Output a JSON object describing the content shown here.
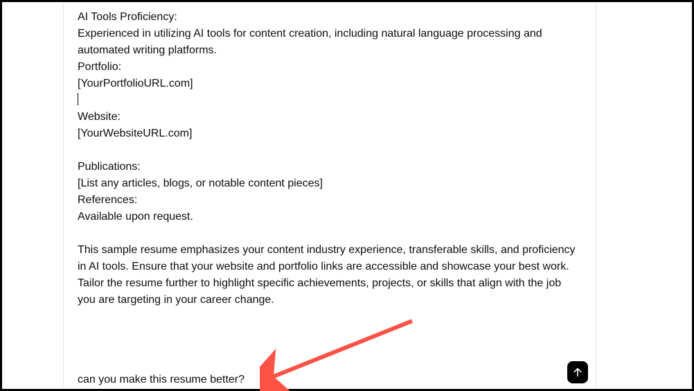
{
  "message": {
    "line1": "AI Tools Proficiency:",
    "line2": "Experienced in utilizing AI tools for content creation, including natural language processing and automated writing platforms.",
    "line3": "Portfolio:",
    "line4": "[YourPortfolioURL.com]",
    "line5": "Website:",
    "line6": "[YourWebsiteURL.com]",
    "line7": "Publications:",
    "line8": "[List any articles, blogs, or notable content pieces]",
    "line9": "References:",
    "line10": "Available upon request.",
    "line11": "This sample resume emphasizes your content industry experience, transferable skills, and proficiency in AI tools. Ensure that your website and portfolio links are accessible and showcase your best work. Tailor the resume further to highlight specific achievements, projects, or skills that align with the job you are targeting in your career change."
  },
  "user_prompt": "can you make this resume better?",
  "annotation_color": "#fd5346"
}
